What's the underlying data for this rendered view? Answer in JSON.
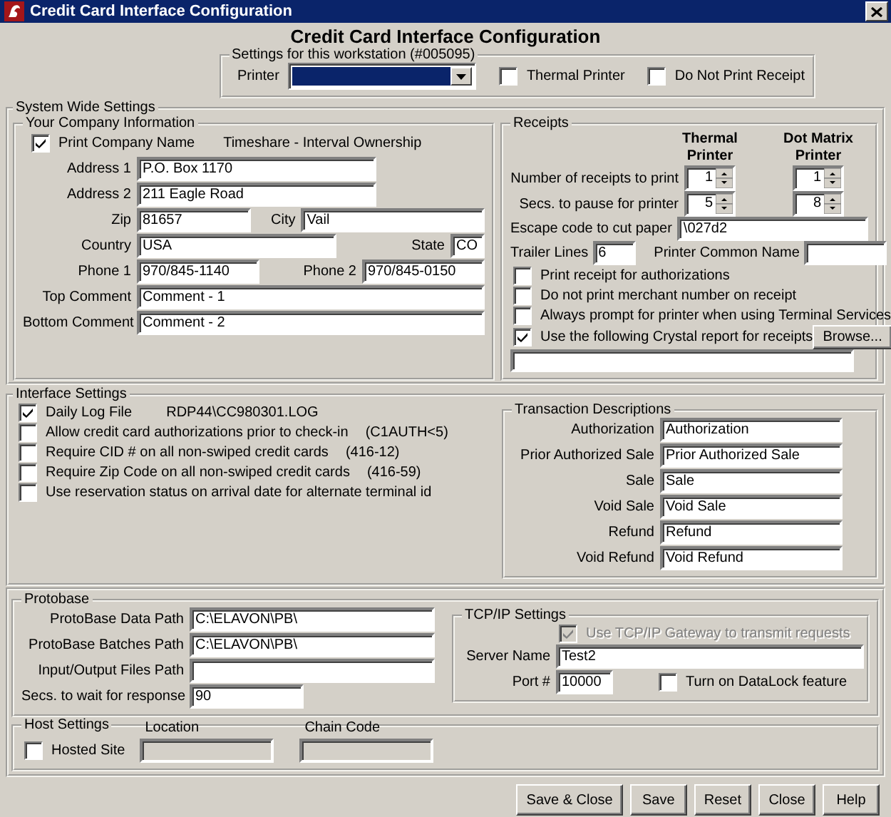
{
  "window": {
    "title": "Credit Card Interface Configuration"
  },
  "heading": "Credit Card Interface Configuration",
  "workstation": {
    "legend": "Settings for this workstation (#005095)",
    "printer": {
      "label": "Printer",
      "highlighted": true
    },
    "options": [
      {
        "label": "Thermal Printer",
        "checked": false
      },
      {
        "label": "Do Not Print Receipt",
        "checked": false
      }
    ]
  },
  "system_wide": {
    "legend": "System Wide Settings",
    "company": {
      "legend": "Your Company Information",
      "print_name": {
        "label": "Print Company Name",
        "checked": true
      },
      "company_name": "Timeshare - Interval Ownership",
      "rows": [
        [
          {
            "label": "Address 1",
            "value": "P.O. Box 1170",
            "kind": "medium"
          }
        ],
        [
          {
            "label": "Address 2",
            "value": "211 Eagle Road",
            "kind": "medium"
          }
        ],
        [
          {
            "label": "Zip",
            "value": "81657",
            "kind": "short"
          },
          {
            "label": "City",
            "value": "Vail",
            "kind": "full"
          }
        ],
        [
          {
            "label": "Country",
            "value": "USA",
            "kind": "wide"
          },
          {
            "label": "State",
            "value": "CO",
            "kind": "tiny"
          }
        ],
        [
          {
            "label": "Phone 1",
            "value": "970/845-1140",
            "kind": "phone"
          },
          {
            "label": "Phone 2",
            "value": "970/845-0150",
            "kind": "phone"
          }
        ],
        [
          {
            "label": "Top Comment",
            "value": "Comment - 1",
            "kind": "full"
          }
        ],
        [
          {
            "label": "Bottom Comment",
            "value": "Comment - 2",
            "kind": "full"
          }
        ]
      ]
    },
    "receipts": {
      "legend": "Receipts",
      "columns": [
        "Thermal Printer",
        "Dot Matrix Printer"
      ],
      "spinners": [
        {
          "label": "Number of receipts to print",
          "values": [
            "1",
            "1"
          ]
        },
        {
          "label": "Secs. to pause for printer",
          "values": [
            "5",
            "8"
          ]
        }
      ],
      "escape_code": {
        "label": "Escape code to cut paper",
        "value": "\\027d2"
      },
      "trailer_lines": {
        "label": "Trailer Lines",
        "value": "6"
      },
      "common_name": {
        "label": "Printer Common Name"
      },
      "options": [
        {
          "label": "Print receipt for authorizations",
          "checked": false
        },
        {
          "label": "Do not print merchant number on receipt",
          "checked": false
        },
        {
          "label": "Always prompt for printer when using Terminal Services",
          "checked": false
        },
        {
          "label": "Use the following Crystal report for receipts",
          "checked": true
        }
      ],
      "browse": "Browse..."
    }
  },
  "interface": {
    "legend": "Interface Settings",
    "options": [
      {
        "label": "Daily Log File",
        "checked": true,
        "note": "RDP44\\CC980301.LOG"
      },
      {
        "label": "Allow credit card authorizations prior to check-in",
        "checked": false,
        "note": "(C1AUTH<5)"
      },
      {
        "label": "Require CID # on all non-swiped credit cards",
        "checked": false,
        "note": "(416-12)"
      },
      {
        "label": "Require Zip Code on all non-swiped credit cards",
        "checked": false,
        "note": "(416-59)"
      },
      {
        "label": "Use reservation status on arrival date for alternate terminal id",
        "checked": false
      }
    ],
    "transactions": {
      "legend": "Transaction Descriptions",
      "rows": [
        {
          "label": "Authorization",
          "value": "Authorization"
        },
        {
          "label": "Prior Authorized Sale",
          "value": "Prior Authorized Sale"
        },
        {
          "label": "Sale",
          "value": "Sale"
        },
        {
          "label": "Void Sale",
          "value": "Void Sale"
        },
        {
          "label": "Refund",
          "value": "Refund"
        },
        {
          "label": "Void Refund",
          "value": "Void Refund"
        }
      ]
    }
  },
  "protobase": {
    "legend": "Protobase",
    "paths": [
      {
        "label": "ProtoBase Data Path",
        "value": "C:\\ELAVON\\PB\\",
        "kind": "long"
      },
      {
        "label": "ProtoBase Batches Path",
        "value": "C:\\ELAVON\\PB\\",
        "kind": "long"
      },
      {
        "label": "Input/Output Files Path",
        "kind": "long"
      },
      {
        "label": "Secs. to wait for response",
        "value": "90",
        "kind": "short"
      }
    ],
    "tcpip": {
      "legend": "TCP/IP Settings",
      "gateway": {
        "label": "Use TCP/IP Gateway to transmit requests",
        "checked": true,
        "disabled": true
      },
      "server": {
        "label": "Server Name",
        "value": "Test2"
      },
      "port": {
        "label": "Port #",
        "value": "10000"
      },
      "datalock": {
        "label": "Turn on DataLock feature",
        "checked": false,
        "disabled": false
      }
    }
  },
  "host": {
    "legend": "Host Settings",
    "hosted": {
      "label": "Hosted Site",
      "checked": false
    },
    "fields": [
      {
        "label": "Location",
        "disabled": true
      },
      {
        "label": "Chain Code",
        "disabled": true
      }
    ]
  },
  "buttons": [
    "Save & Close",
    "Save",
    "Reset",
    "Close",
    "Help"
  ]
}
